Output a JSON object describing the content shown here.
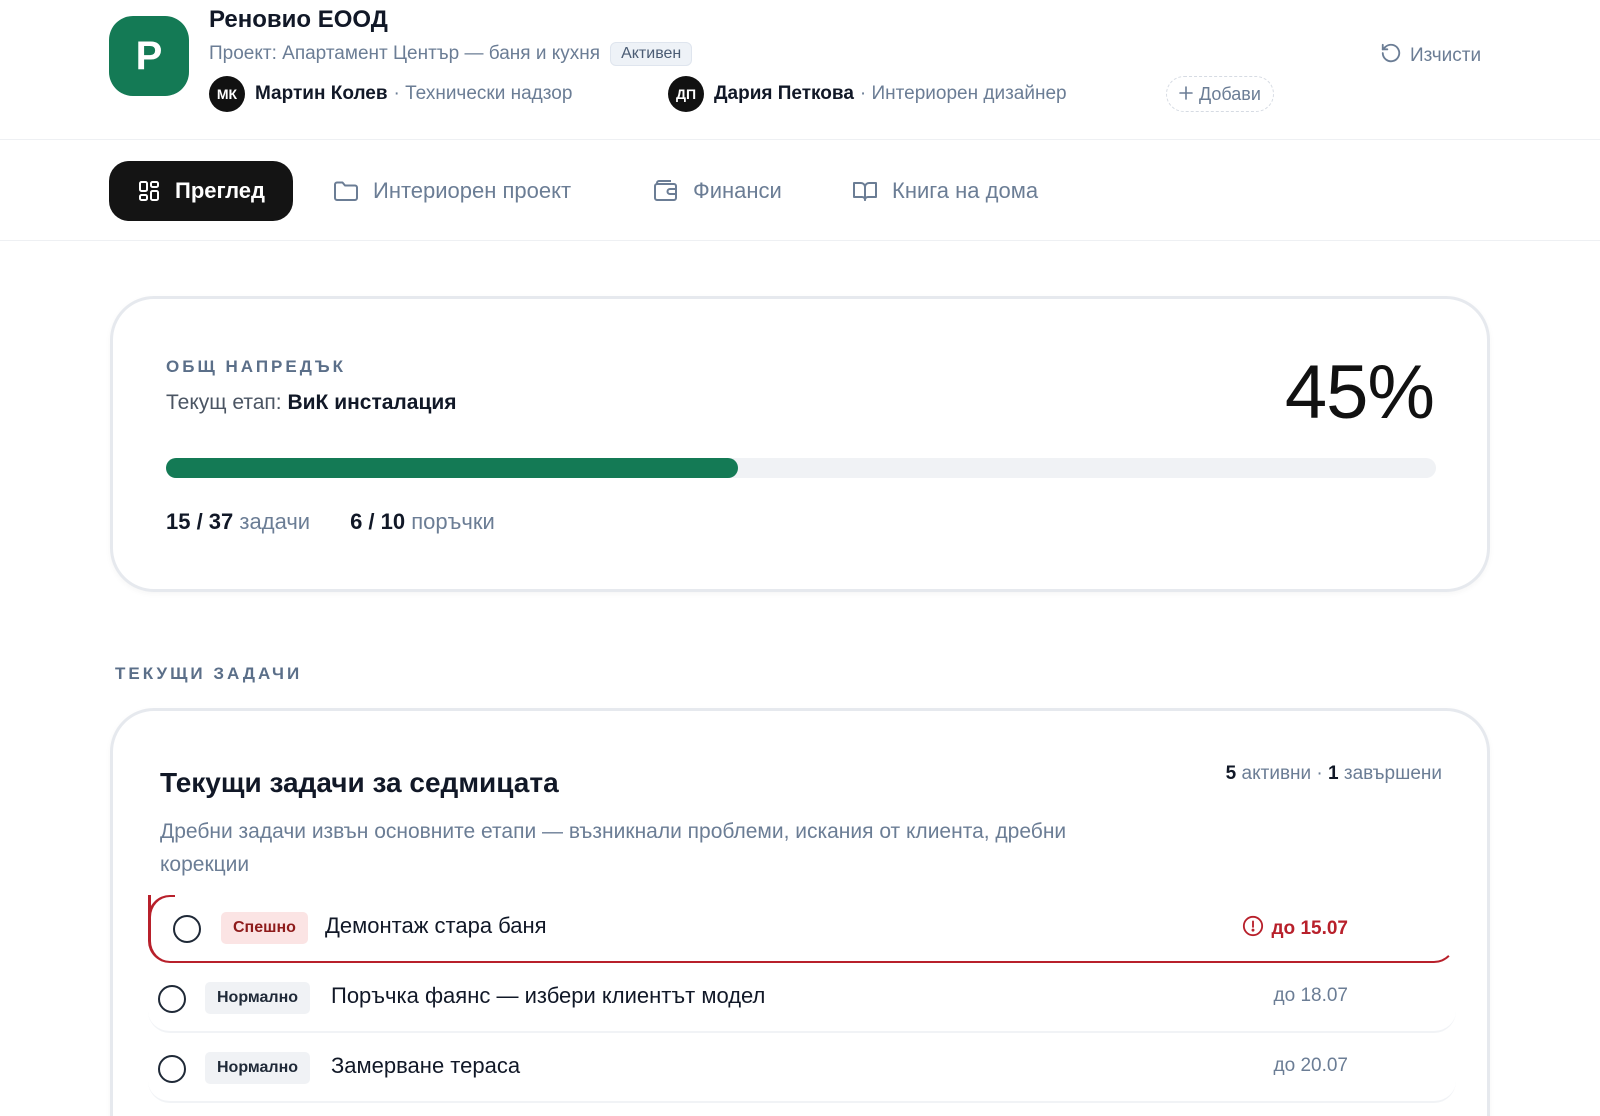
{
  "header": {
    "logo_letter": "Р",
    "company": "Реновио ЕООД",
    "project": "Проект: Апартамент Център — баня и кухня",
    "status": "Активен",
    "team": [
      {
        "initials": "МК",
        "name": "Мартин Колев",
        "role": "· Технически надзор"
      },
      {
        "initials": "ДП",
        "name": "Дария Петкова",
        "role": "· Интериорен дизайнер"
      }
    ],
    "add_label": "Добави",
    "clear_label": "Изчисти"
  },
  "tabs": [
    {
      "label": "Преглед",
      "icon": "grid-icon",
      "active": true
    },
    {
      "label": "Интериорен проект",
      "icon": "folder-icon",
      "active": false
    },
    {
      "label": "Финанси",
      "icon": "wallet-icon",
      "active": false
    },
    {
      "label": "Книга на дома",
      "icon": "book-icon",
      "active": false
    }
  ],
  "progress": {
    "overline": "ОБЩ НАПРЕДЪК",
    "stage_label": "Текущ етап:",
    "stage_value": "ВиК инсталация",
    "percent_text": "45%",
    "percent_value": 0.45,
    "tasks_count": "15 / 37",
    "tasks_label": "задачи",
    "orders_count": "6 / 10",
    "orders_label": "поръчки"
  },
  "section_label": "ТЕКУЩИ ЗАДАЧИ",
  "tasks_card": {
    "title": "Текущи задачи за седмицата",
    "active_count": "5",
    "active_label": "активни ·",
    "done_count": "1",
    "done_label": "завършени",
    "description": "Дребни задачи извън основните етапи — възникнали проблеми, искания от клиента, дребни корекции",
    "tasks": [
      {
        "priority": "Спешно",
        "title": "Демонтаж стара баня",
        "due": "до 15.07"
      },
      {
        "priority": "Нормално",
        "title": "Поръчка фаянс — избери клиентът модел",
        "due": "до 18.07"
      },
      {
        "priority": "Нормално",
        "title": "Замерване тераса",
        "due": "до 20.07"
      }
    ]
  },
  "colors": {
    "brand": "#147a55",
    "urgent": "#b8202b",
    "muted": "#6b7d95"
  }
}
